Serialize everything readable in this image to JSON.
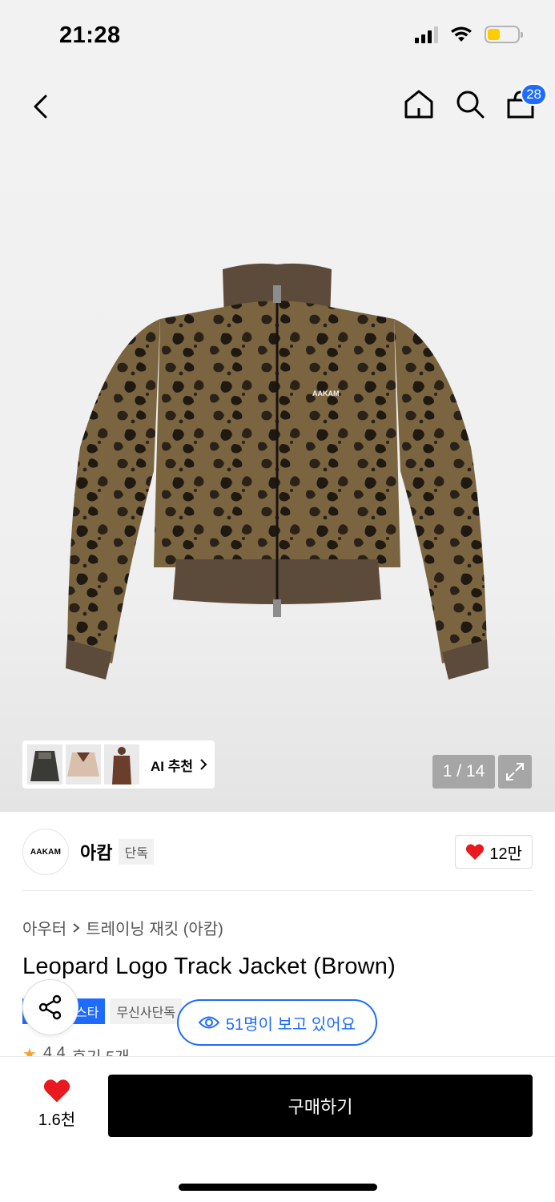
{
  "status_bar": {
    "time": "21:28"
  },
  "nav": {
    "cart_count": "28"
  },
  "gallery": {
    "ai_label": "AI 추천",
    "page_counter": "1 / 14",
    "product_logo_text": "AAKAM"
  },
  "brand": {
    "logo_text": "AAKAM",
    "name": "아캄",
    "tag": "단독",
    "likes": "12만"
  },
  "breadcrumb": {
    "category": "아우터",
    "subcategory": "트레이닝 재킷 (아캄)"
  },
  "product": {
    "title": "Leopard Logo Track Jacket (Brown)"
  },
  "badges": {
    "blue": "스타",
    "gray": "무신사단독"
  },
  "viewers": {
    "text": "51명이 보고 있어요"
  },
  "rating": {
    "score": "4.4",
    "reviews": "후기 5개"
  },
  "bottom": {
    "wish_count": "1.6천",
    "buy_label": "구매하기"
  },
  "colors": {
    "accent": "#1e6bff",
    "heart": "#e8191f",
    "buy_bg": "#000000"
  }
}
